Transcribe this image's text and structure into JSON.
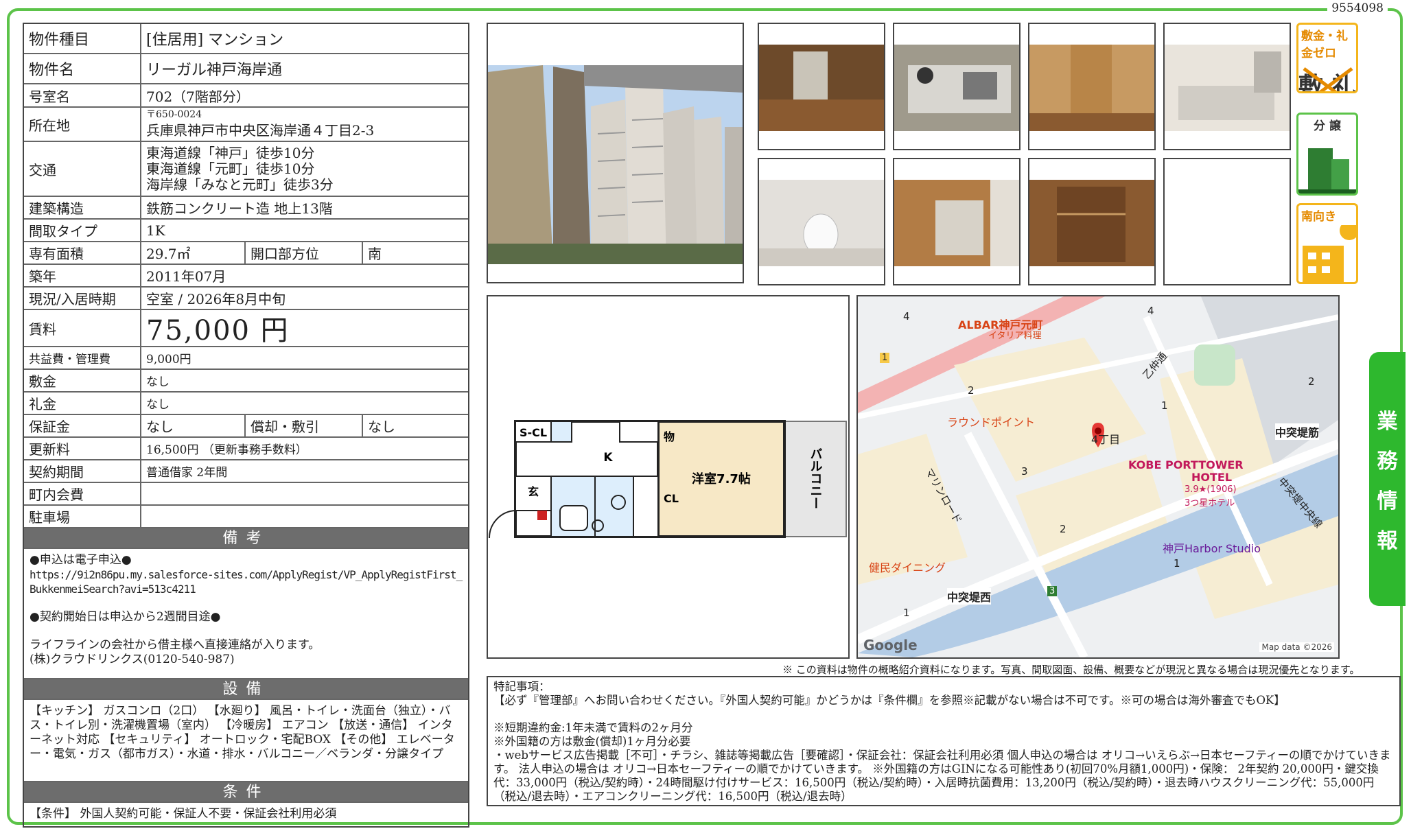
{
  "doc_id": "9554098",
  "property": {
    "type_label": "物件種目",
    "type_value": "[住居用] マンション",
    "name_label": "物件名",
    "name_value": "リーガル神戸海岸通",
    "room_label": "号室名",
    "room_value": "702（7階部分）",
    "address_label": "所在地",
    "zip": "〒650-0024",
    "address": "兵庫県神戸市中央区海岸通４丁目2-3",
    "transit_label": "交通",
    "transit": [
      "東海道線「神戸」徒歩10分",
      "東海道線「元町」徒歩10分",
      "海岸線「みなと元町」徒歩3分"
    ],
    "structure_label": "建築構造",
    "structure_value": "鉄筋コンクリート造 地上13階",
    "layout_label": "間取タイプ",
    "layout_value": "1K",
    "area_label": "専有面積",
    "area_value": "29.7㎡",
    "facing_label": "開口部方位",
    "facing_value": "南",
    "built_label": "築年",
    "built_value": "2011年07月",
    "status_label": "現況/入居時期",
    "status_value": "空室 / 2026年8月中旬",
    "rent_label": "賃料",
    "rent_value": "75,000 円",
    "fee_label": "共益費・管理費",
    "fee_value": "9,000円",
    "deposit_label": "敷金",
    "deposit_value": "なし",
    "key_money_label": "礼金",
    "key_money_value": "なし",
    "guarantee_label": "保証金",
    "guarantee_value": "なし",
    "amort_label": "償却・敷引",
    "amort_value": "なし",
    "renewal_label": "更新料",
    "renewal_value": "16,500円 （更新事務手数料）",
    "contract_label": "契約期間",
    "contract_value": "普通借家 2年間",
    "assoc_label": "町内会費",
    "assoc_value": "",
    "parking_label": "駐車場",
    "parking_value": ""
  },
  "remarks": {
    "heading": "備考",
    "line1": "●申込は電子申込●",
    "url": "https://9i2n86pu.my.salesforce-sites.com/ApplyRegist/VP_ApplyRegistFirst_BukkenmeiSearch?avi=513c4211",
    "line2": "●契約開始日は申込から2週間目途●",
    "line3": "ライフラインの会社から借主様へ直接連絡が入ります。",
    "line4": "(株)クラウドリンクス(0120-540-987)"
  },
  "equipment": {
    "heading": "設備",
    "text": "【キッチン】 ガスコンロ（2口） 【水廻り】 風呂・トイレ・洗面台（独立）・バス・トイレ別・洗濯機置場（室内） 【冷暖房】 エアコン 【放送・通信】 インターネット対応 【セキュリティ】 オートロック・宅配BOX 【その他】 エレベーター・電気・ガス（都市ガス）・水道・排水・バルコニー／ベランダ・分譲タイプ"
  },
  "conditions": {
    "heading": "条件",
    "text": "【条件】 外国人契約可能・保証人不要・保証会社利用必須"
  },
  "badges": {
    "zero_title": "敷金・礼金ゼロ",
    "zero_glyph": "敷 礼",
    "bunjo_title": "分 譲",
    "south_title": "南向き"
  },
  "floorplan": {
    "scl": "S-CL",
    "k": "K",
    "mono": "物",
    "genkan": "玄",
    "cl": "CL",
    "room": "洋室7.7帖",
    "balcony": "バルコニー"
  },
  "map": {
    "albar": "ALBAR神戸元町",
    "italian": "イタリア料理",
    "roundpoint": "ラウンドポイント",
    "chome": "4丁目",
    "kobe_hotel": "KOBE PORTTOWER",
    "hotel": "HOTEL",
    "rating": "3.9★(1906)",
    "stars": "3つ星ホテル",
    "harbor": "神戸Harbor Studio",
    "kenmin": "健民ダイニング",
    "nakatsutsumi_w": "中突堤西",
    "nakatsutsumi_s": "中突堤筋",
    "nakatsutsumi_c": "中突堤中央線",
    "otsunaka": "乙仲通",
    "marine": "マリンロード",
    "google": "Google",
    "mapdata": "Map data ©2026",
    "n1": "1",
    "n2": "2",
    "n3": "3",
    "n4": "4",
    "route1": "1",
    "route3": "3"
  },
  "notice": "※ この資料は物件の概略紹介資料になります。写真、間取図面、設備、概要などが現況と異なる場合は現況優先となります。",
  "special": {
    "heading": "特記事項：",
    "l1": "【必ず『管理部』へお問い合わせください。『外国人契約可能』かどうかは『条件欄』を参照※記載がない場合は不可です。※可の場合は海外審査でもOK】",
    "l2": "※短期違約金:1年未満で賃料の2ヶ月分",
    "l3": "※外国籍の方は敷金(償却)1ヶ月分必要",
    "l4": "・webサービス広告掲載［不可］・チラシ、雑誌等掲載広告［要確認］・保証会社：保証会社利用必須 個人申込の場合は オリコ→いえらぶ→日本セーフティーの順でかけていきます。 法人申込の場合は オリコ→日本セーフティーの順でかけていきます。 ※外国籍の方はGINになる可能性あり(初回70%月額1,000円)・保険： 2年契約 20,000円・鍵交換代：33,000円（税込/契約時）・24時間駆け付けサービス：16,500円（税込/契約時）・入居時抗菌費用：13,200円（税込/契約時）・退去時ハウスクリーニング代：55,000円（税込/退去時）・エアコンクリーニング代：16,500円（税込/退去時）"
  },
  "side_tab": [
    "業",
    "務",
    "情",
    "報"
  ],
  "colors": {
    "frame": "#5cc349",
    "section": "#6d6d6d",
    "badge_orange": "#f4b51b",
    "tab_green": "#2eb82e"
  }
}
